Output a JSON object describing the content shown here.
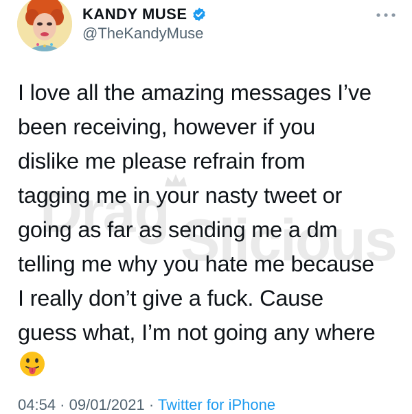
{
  "profile": {
    "display_name": "KANDY MUSE",
    "handle": "@TheKandyMuse",
    "verified_icon": "verified-badge-icon",
    "avatar": "avatar-image",
    "colors": {
      "verified": "#1d9bf0"
    }
  },
  "header": {
    "more_icon": "more-options-icon"
  },
  "tweet": {
    "text": "I love all the amazing messages I’ve\nbeen receiving, however if you\ndislike me please refrain from\ntagging me in your nasty tweet or\ngoing as far as sending me a dm\ntelling me why you hate me because\nI really don’t give a fuck. Cause\nguess what, I’m not going any where",
    "emoji": "tongue-out-emoji"
  },
  "watermark": {
    "text_part1": "Drag",
    "text_part2": "Slicious"
  },
  "meta": {
    "time": "04:54",
    "separator1": " · ",
    "date": "09/01/2021",
    "separator2": " · ",
    "app": "Twitter for iPhone",
    "colors": {
      "text": "#536471",
      "link": "#1d9bf0"
    }
  }
}
